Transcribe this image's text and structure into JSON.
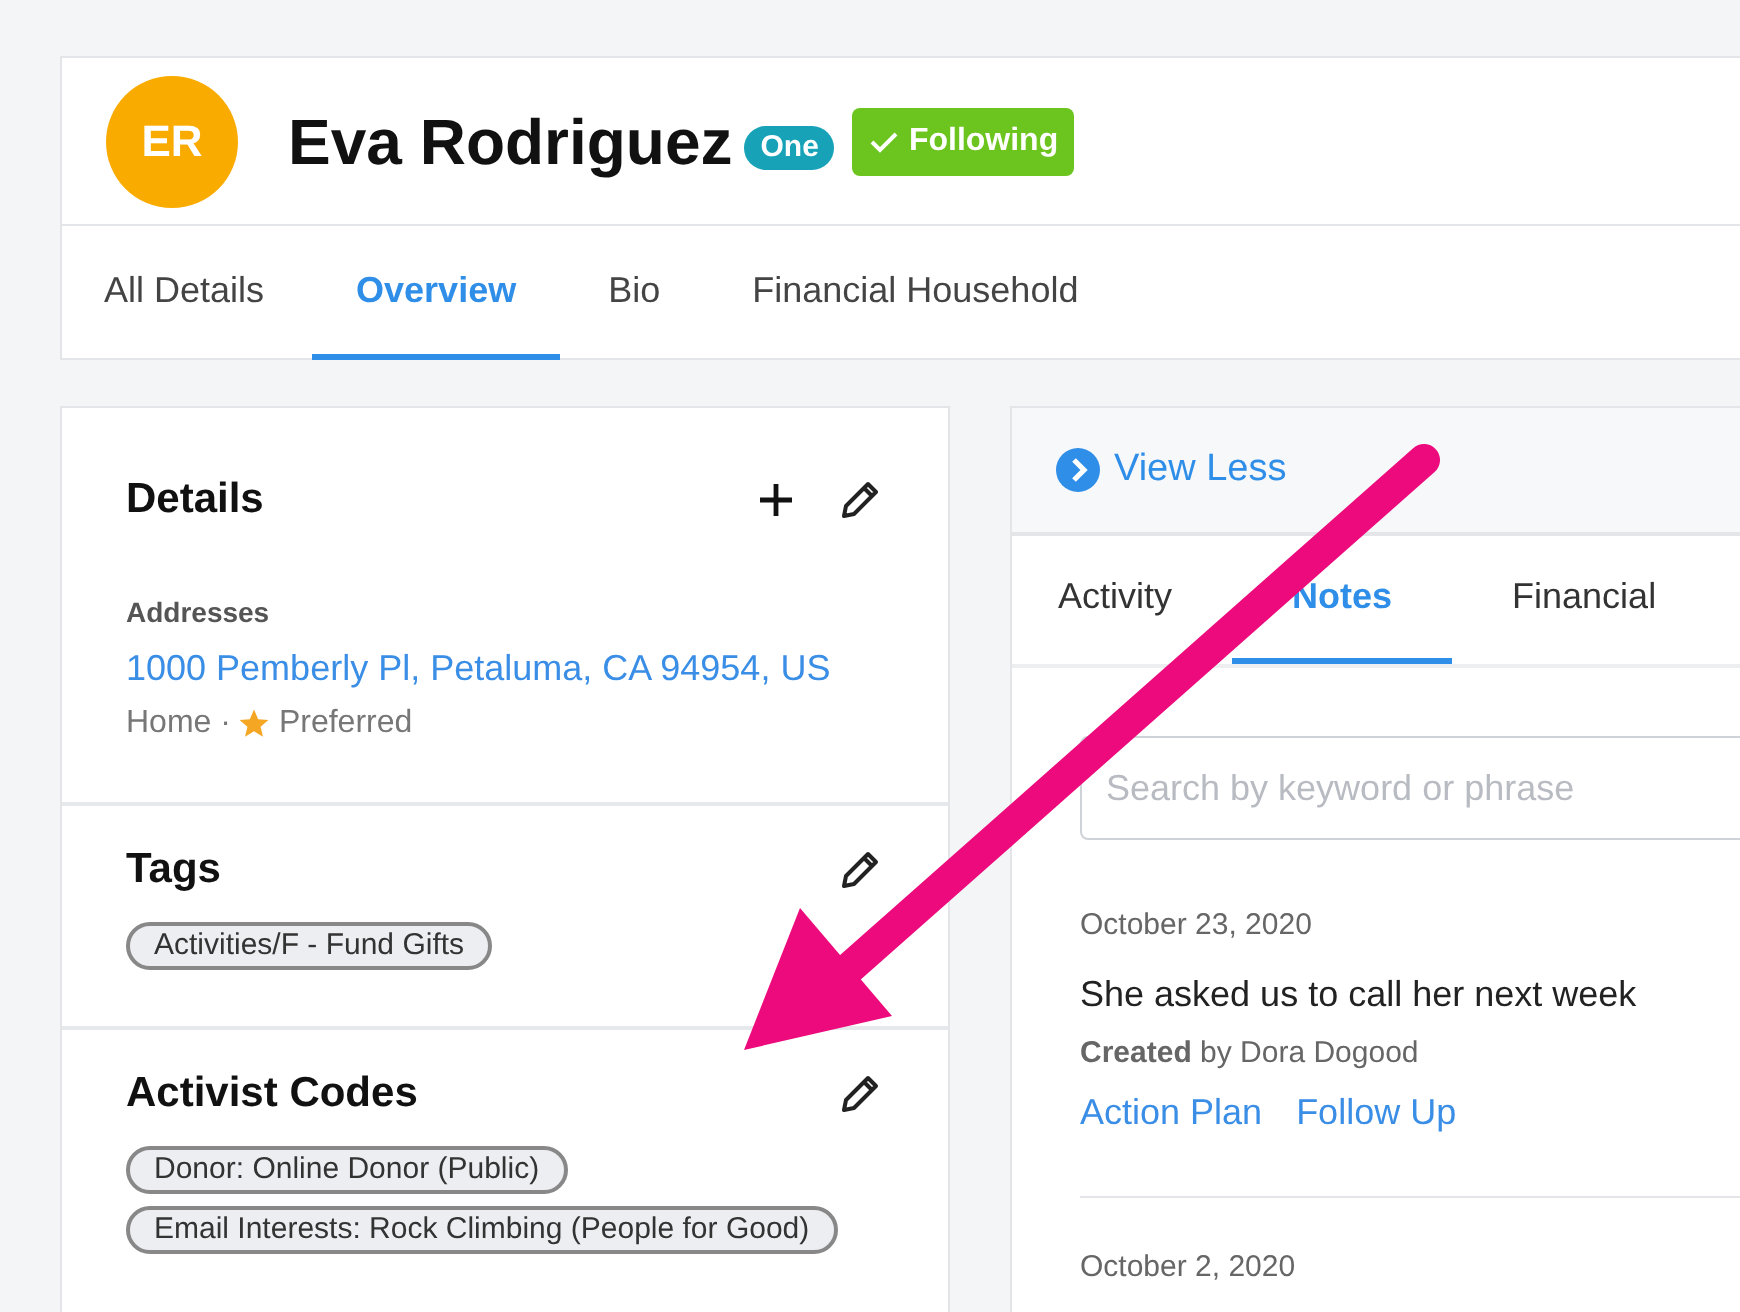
{
  "header": {
    "initials": "ER",
    "name": "Eva Rodriguez",
    "badge": "One",
    "follow_button": {
      "label": "Following",
      "on": true
    }
  },
  "tabs": [
    {
      "label": "All Details",
      "selected": false
    },
    {
      "label": "Overview",
      "selected": true
    },
    {
      "label": "Bio",
      "selected": false
    },
    {
      "label": "Financial Household",
      "selected": false
    }
  ],
  "details": {
    "title": "Details",
    "addresses_label": "Addresses",
    "address": "1000 Pemberly Pl, Petaluma, CA 94954, US",
    "address_type": "Home ·",
    "preferred": {
      "label": "Preferred",
      "on": true
    }
  },
  "tags": {
    "title": "Tags",
    "items": [
      "Activities/F - Fund Gifts"
    ]
  },
  "activist_codes": {
    "title": "Activist Codes",
    "items": [
      "Donor: Online Donor (Public)",
      "Email Interests: Rock Climbing (People for Good)"
    ]
  },
  "view_less": "View Less",
  "panel_tabs": [
    {
      "label": "Activity",
      "selected": false
    },
    {
      "label": "Notes",
      "selected": true
    },
    {
      "label": "Financial",
      "selected": false
    }
  ],
  "search": {
    "placeholder": "Search by keyword or phrase"
  },
  "notes": [
    {
      "date": "October 23, 2020",
      "text": "She asked us to call her next week",
      "author": "**Created** by Dora Dogood",
      "links": [
        "Action Plan",
        "Follow Up"
      ]
    },
    {
      "date": "October 2, 2020"
    }
  ]
}
